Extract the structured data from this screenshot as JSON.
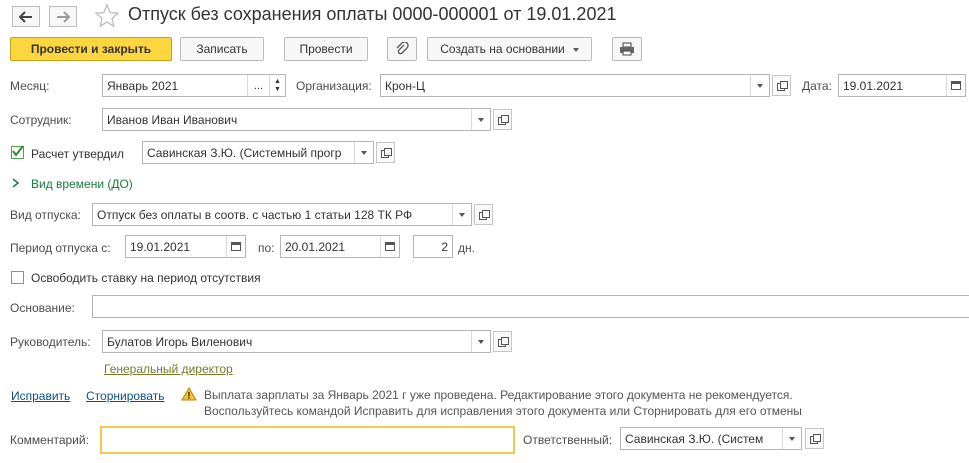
{
  "header": {
    "title": "Отпуск без сохранения оплаты 0000-000001 от 19.01.2021",
    "back_icon": "arrow-left-icon",
    "forward_icon": "arrow-right-icon",
    "favorite_icon": "star-icon"
  },
  "toolbar": {
    "post_close_label": "Провести и закрыть",
    "save_label": "Записать",
    "post_label": "Провести",
    "attach_icon": "paperclip-icon",
    "create_basis_label": "Создать на основании",
    "print_icon": "printer-icon",
    "accent_color": "#fbd63e"
  },
  "form": {
    "month_label": "Месяц:",
    "month_value": "Январь 2021",
    "month_dots": "...",
    "organization_label": "Организация:",
    "organization_value": "Крон-Ц",
    "date_label": "Дата:",
    "date_value": "19.01.2021",
    "employee_label": "Сотрудник:",
    "employee_value": "Иванов Иван Иванович",
    "calc_approved_label": "Расчет утвердил",
    "calc_approved_checked": true,
    "calc_approved_value": "Савинская З.Ю. (Системный прогр",
    "time_type_label": "Вид времени (ДО)",
    "leave_type_label": "Вид отпуска:",
    "leave_type_value": "Отпуск без оплаты в соотв. с частью 1 статьи 128 ТК РФ",
    "period_from_label": "Период отпуска с:",
    "period_from_value": "19.01.2021",
    "period_to_label": "по:",
    "period_to_value": "20.01.2021",
    "days_value": "2",
    "days_unit": "дн.",
    "free_rate_label": "Освободить ставку на период отсутствия",
    "free_rate_checked": false,
    "basis_label": "Основание:",
    "basis_value": "",
    "manager_label": "Руководитель:",
    "manager_value": "Булатов Игорь Виленович",
    "manager_position": "Генеральный директор",
    "fix_link": "Исправить",
    "reverse_link": "Сторнировать",
    "warning_line1": "Выплата зарплаты за Январь 2021 г уже проведена. Редактирование этого документа не рекомендуется.",
    "warning_line2": "Воспользуйтесь командой Исправить для исправления этого документа или Сторнировать для его отмены",
    "comment_label": "Комментарий:",
    "comment_value": "",
    "responsible_label": "Ответственный:",
    "responsible_value": "Савинская З.Ю. (Систем"
  }
}
